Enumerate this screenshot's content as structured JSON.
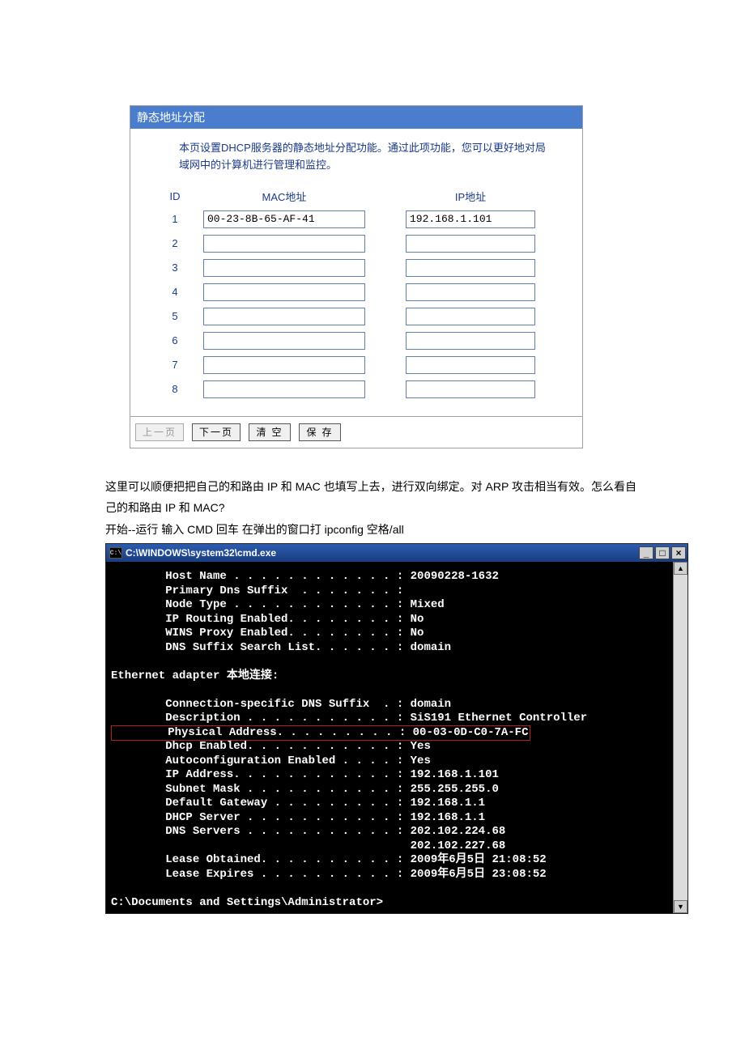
{
  "panel": {
    "title": "静态地址分配",
    "description": "本页设置DHCP服务器的静态地址分配功能。通过此项功能，您可以更好地对局域网中的计算机进行管理和监控。",
    "headers": {
      "id": "ID",
      "mac": "MAC地址",
      "ip": "IP地址"
    },
    "rows": [
      {
        "id": "1",
        "mac": "00-23-8B-65-AF-41",
        "ip": "192.168.1.101"
      },
      {
        "id": "2",
        "mac": "",
        "ip": ""
      },
      {
        "id": "3",
        "mac": "",
        "ip": ""
      },
      {
        "id": "4",
        "mac": "",
        "ip": ""
      },
      {
        "id": "5",
        "mac": "",
        "ip": ""
      },
      {
        "id": "6",
        "mac": "",
        "ip": ""
      },
      {
        "id": "7",
        "mac": "",
        "ip": ""
      },
      {
        "id": "8",
        "mac": "",
        "ip": ""
      }
    ],
    "buttons": {
      "prev": "上一页",
      "next": "下一页",
      "clear": "清 空",
      "save": "保 存"
    }
  },
  "bodytext": {
    "p1": "这里可以顺便把把自己的和路由 IP 和 MAC 也填写上去，进行双向绑定。对 ARP 攻击相当有效。怎么看自己的和路由 IP 和 MAC?",
    "p2": "开始--运行  输入 CMD  回车 在弹出的窗口打 ipconfig 空格/all"
  },
  "cmd": {
    "title": "C:\\WINDOWS\\system32\\cmd.exe",
    "icon_label": "C:\\",
    "lines": {
      "hostname": "        Host Name . . . . . . . . . . . . : 20090228-1632",
      "dnssuffix": "        Primary Dns Suffix  . . . . . . . :",
      "nodetype": "        Node Type . . . . . . . . . . . . : Mixed",
      "iprouting": "        IP Routing Enabled. . . . . . . . : No",
      "winsproxy": "        WINS Proxy Enabled. . . . . . . . : No",
      "dnslist": "        DNS Suffix Search List. . . . . . : domain",
      "adapterhdr": "Ethernet adapter 本地连接:",
      "connsuffix": "        Connection-specific DNS Suffix  . : domain",
      "descr": "        Description . . . . . . . . . . . : SiS191 Ethernet Controller",
      "physaddr": "        Physical Address. . . . . . . . . : 00-03-0D-C0-7A-FC",
      "dhcp": "        Dhcp Enabled. . . . . . . . . . . : Yes",
      "autoconf": "        Autoconfiguration Enabled . . . . : Yes",
      "ipaddr": "        IP Address. . . . . . . . . . . . : 192.168.1.101",
      "subnet": "        Subnet Mask . . . . . . . . . . . : 255.255.255.0",
      "gateway": "        Default Gateway . . . . . . . . . : 192.168.1.1",
      "dhcpsrv": "        DHCP Server . . . . . . . . . . . : 192.168.1.1",
      "dns1": "        DNS Servers . . . . . . . . . . . : 202.102.224.68",
      "dns2": "                                            202.102.227.68",
      "leaseobt": "        Lease Obtained. . . . . . . . . . : 2009年6月5日 21:08:52",
      "leaseexp": "        Lease Expires . . . . . . . . . . : 2009年6月5日 23:08:52",
      "prompt": "C:\\Documents and Settings\\Administrator>"
    }
  }
}
